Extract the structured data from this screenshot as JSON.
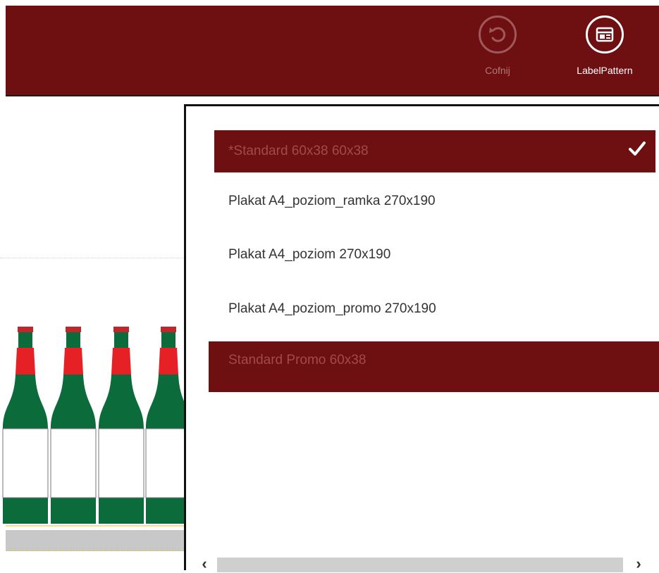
{
  "appbar": {
    "background": "#6e0f12",
    "commands": [
      {
        "label": "Cofnij",
        "icon": "undo-icon",
        "disabled": true
      },
      {
        "label": "LabelPattern",
        "icon": "label-pattern-icon",
        "disabled": false
      }
    ]
  },
  "flyout": {
    "items": [
      {
        "label": "*Standard 60x38  60x38",
        "selected": true,
        "checked": true
      },
      {
        "label": "Plakat A4_poziom_ramka  270x190",
        "selected": false
      },
      {
        "label": "Plakat A4_poziom  270x190",
        "selected": false
      },
      {
        "label": "Plakat A4_poziom_promo  270x190",
        "selected": false
      },
      {
        "label": "Standard Promo  60x38",
        "selected": true
      }
    ],
    "scrollbar": {
      "left_arrow": "‹",
      "right_arrow": "›"
    }
  },
  "canvas": {
    "bottle_colors": {
      "neck": "#e52126",
      "body": "#0b6b3a",
      "label": "#ffffff",
      "cap": "#c0272d"
    }
  }
}
